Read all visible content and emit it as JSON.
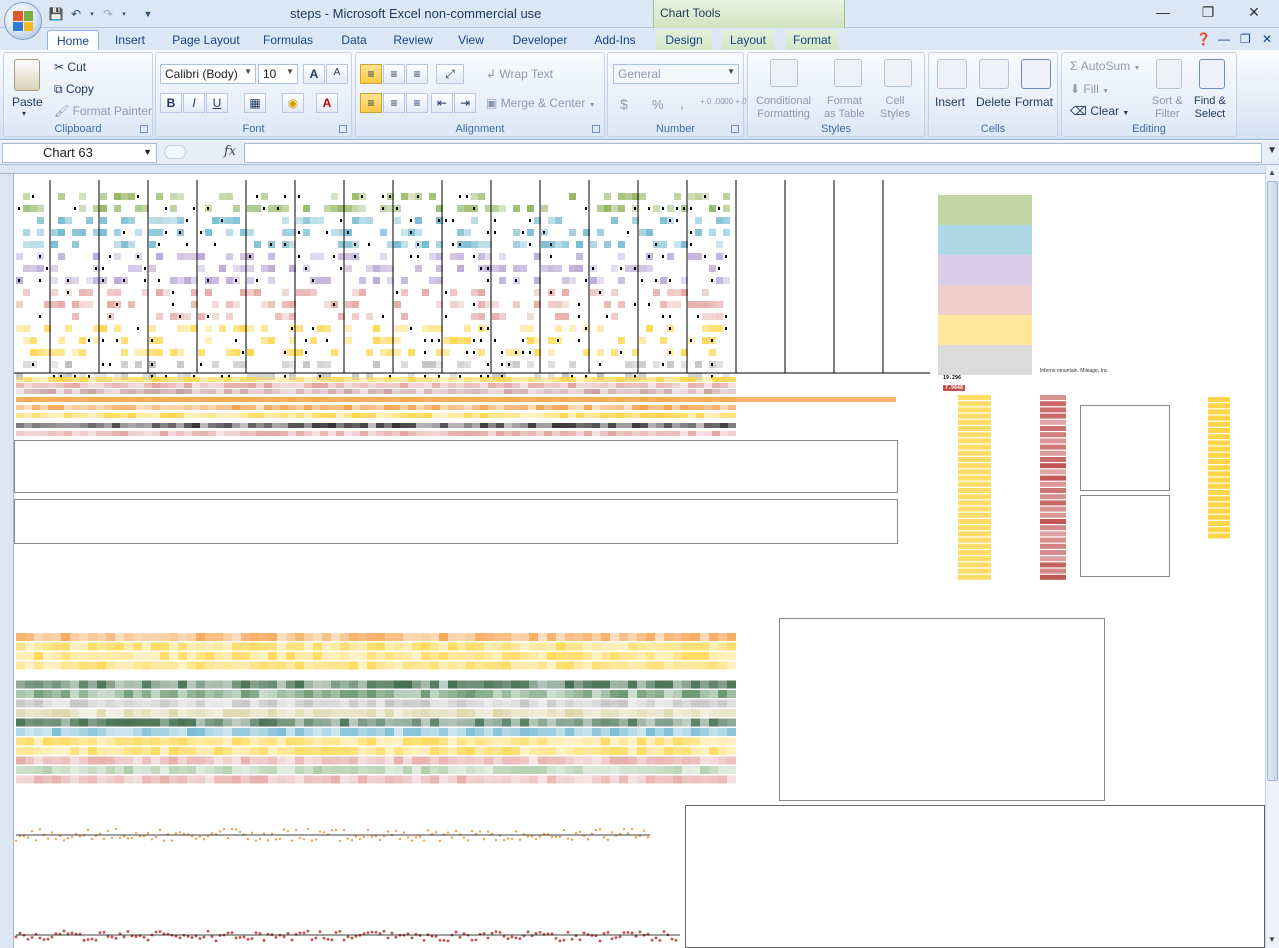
{
  "window": {
    "title": "steps - Microsoft Excel non-commercial use",
    "contextual_group": "Chart Tools",
    "controls": {
      "minimize": "—",
      "restore": "❐",
      "close": "✕"
    }
  },
  "tabs": [
    "Home",
    "Insert",
    "Page Layout",
    "Formulas",
    "Data",
    "Review",
    "View",
    "Developer",
    "Add-Ins",
    "Design",
    "Layout",
    "Format"
  ],
  "ribbon": {
    "clipboard": {
      "label": "Clipboard",
      "paste": "Paste",
      "cut": "Cut",
      "copy": "Copy",
      "format_painter": "Format Painter"
    },
    "font": {
      "label": "Font",
      "font_name": "Calibri (Body)",
      "font_size": "10",
      "bold": "B",
      "italic": "I",
      "underline": "U"
    },
    "alignment": {
      "label": "Alignment",
      "wrap_text": "Wrap Text",
      "merge_center": "Merge & Center"
    },
    "number": {
      "label": "Number",
      "format": "General",
      "currency": "$",
      "percent": "%",
      "comma": ",",
      "inc_decimal": "+.0 .00",
      "dec_decimal": ".00 +.0"
    },
    "styles": {
      "label": "Styles",
      "conditional": "Conditional",
      "conditional2": "Formatting",
      "format_table": "Format",
      "format_table2": "as Table",
      "cell_styles": "Cell",
      "cell_styles2": "Styles"
    },
    "cells": {
      "label": "Cells",
      "insert": "Insert",
      "delete": "Delete",
      "format": "Format"
    },
    "editing": {
      "label": "Editing",
      "autosum": "AutoSum",
      "fill": "Fill",
      "clear": "Clear",
      "sort_filter": "Sort &",
      "sort_filter2": "Filter",
      "find_select": "Find &",
      "find_select2": "Select"
    }
  },
  "formula_bar": {
    "name_box": "Chart 63",
    "fx": "fx",
    "formula": ""
  },
  "sheet_text": {
    "note_right": "Inferno mountain. Mileage, Inc.",
    "value_a": "19.296",
    "value_b": "7.9848"
  },
  "colors": {
    "green": "#8fb35a",
    "blue": "#6fb7cf",
    "purple": "#b9a6d6",
    "pink": "#e3a5a0",
    "yellow": "#ffd64a",
    "gray": "#bdbdbd",
    "orange": "#f6a04a",
    "red": "#c0392b"
  }
}
